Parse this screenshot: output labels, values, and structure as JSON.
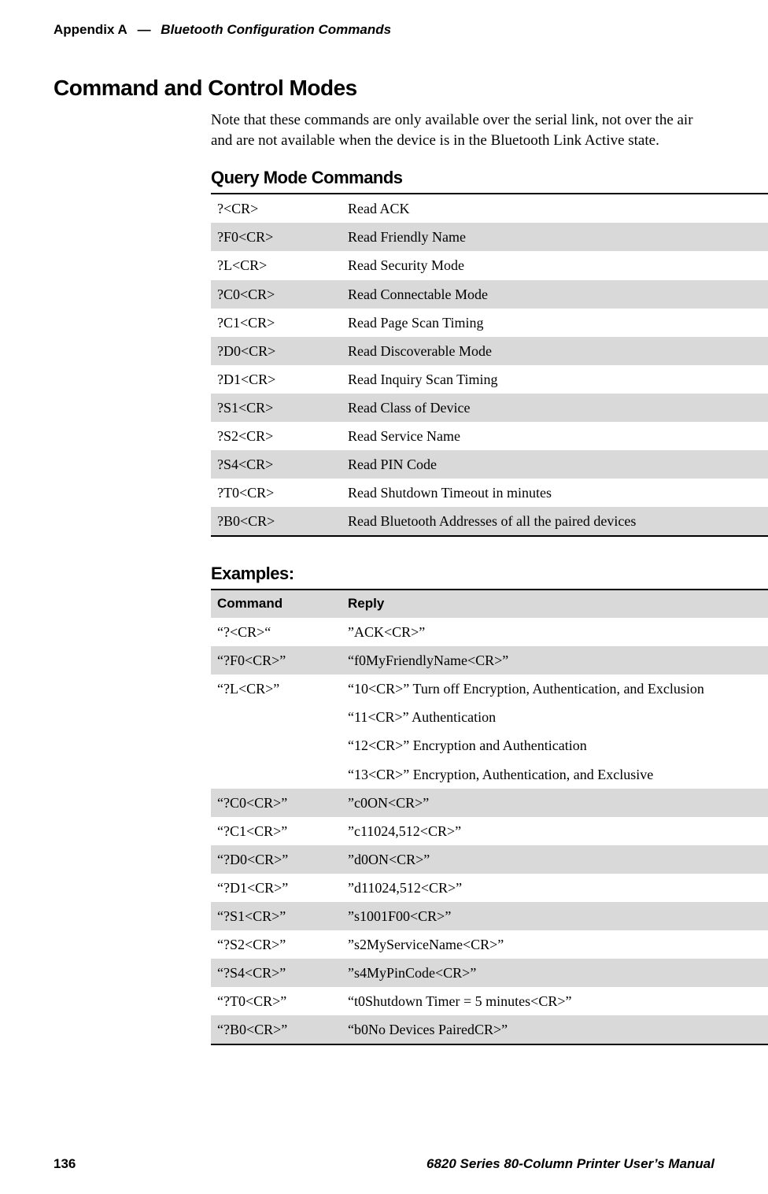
{
  "header": {
    "appendix_label": "Appendix  A",
    "dash": "—",
    "chapter_title": "Bluetooth Configuration Commands"
  },
  "h1": "Command and Control Modes",
  "intro": "Note that these commands are only available over the serial link, not over the air and are not available when the device is in the Bluetooth Link Active state.",
  "query_section": {
    "heading": "Query Mode Commands",
    "rows": [
      {
        "cmd": "?<CR>",
        "desc": "Read ACK"
      },
      {
        "cmd": "?F0<CR>",
        "desc": "Read Friendly Name"
      },
      {
        "cmd": "?L<CR>",
        "desc": "Read Security Mode"
      },
      {
        "cmd": "?C0<CR>",
        "desc": "Read Connectable Mode"
      },
      {
        "cmd": "?C1<CR>",
        "desc": "Read Page Scan Timing"
      },
      {
        "cmd": "?D0<CR>",
        "desc": "Read Discoverable Mode"
      },
      {
        "cmd": "?D1<CR>",
        "desc": "Read Inquiry Scan Timing"
      },
      {
        "cmd": "?S1<CR>",
        "desc": "Read Class of Device"
      },
      {
        "cmd": "?S2<CR>",
        "desc": "Read Service Name"
      },
      {
        "cmd": "?S4<CR>",
        "desc": "Read PIN Code"
      },
      {
        "cmd": "?T0<CR>",
        "desc": "Read Shutdown Timeout in minutes"
      },
      {
        "cmd": "?B0<CR>",
        "desc": "Read Bluetooth Addresses of all the paired devices"
      }
    ]
  },
  "examples_section": {
    "heading": "Examples:",
    "col_command": "Command",
    "col_reply": "Reply",
    "rows": [
      {
        "cmd": "“?<CR>“",
        "reply": [
          "”ACK<CR>”"
        ]
      },
      {
        "cmd": "“?F0<CR>”",
        "reply": [
          "“f0MyFriendlyName<CR>”"
        ]
      },
      {
        "cmd": "“?L<CR>”",
        "reply": [
          "“10<CR>” Turn off Encryption, Authentication, and Exclusion",
          "“11<CR>” Authentication",
          "“12<CR>” Encryption and Authentication",
          "“13<CR>” Encryption, Authentication, and Exclusive"
        ]
      },
      {
        "cmd": "“?C0<CR>”",
        "reply": [
          "”c0ON<CR>”"
        ]
      },
      {
        "cmd": "“?C1<CR>”",
        "reply": [
          "”c11024,512<CR>”"
        ]
      },
      {
        "cmd": "“?D0<CR>”",
        "reply": [
          "”d0ON<CR>”"
        ]
      },
      {
        "cmd": "“?D1<CR>”",
        "reply": [
          "”d11024,512<CR>”"
        ]
      },
      {
        "cmd": "“?S1<CR>”",
        "reply": [
          "”s1001F00<CR>”"
        ]
      },
      {
        "cmd": "“?S2<CR>”",
        "reply": [
          "”s2MyServiceName<CR>”"
        ]
      },
      {
        "cmd": "“?S4<CR>”",
        "reply": [
          "”s4MyPinCode<CR>”"
        ]
      },
      {
        "cmd": "“?T0<CR>”",
        "reply": [
          "“t0Shutdown Timer = 5 minutes<CR>”"
        ]
      },
      {
        "cmd": "“?B0<CR>”",
        "reply": [
          "“b0No Devices PairedCR>”"
        ]
      }
    ]
  },
  "footer": {
    "page_number": "136",
    "manual_title": "6820 Series 80-Column Printer User’s Manual"
  }
}
